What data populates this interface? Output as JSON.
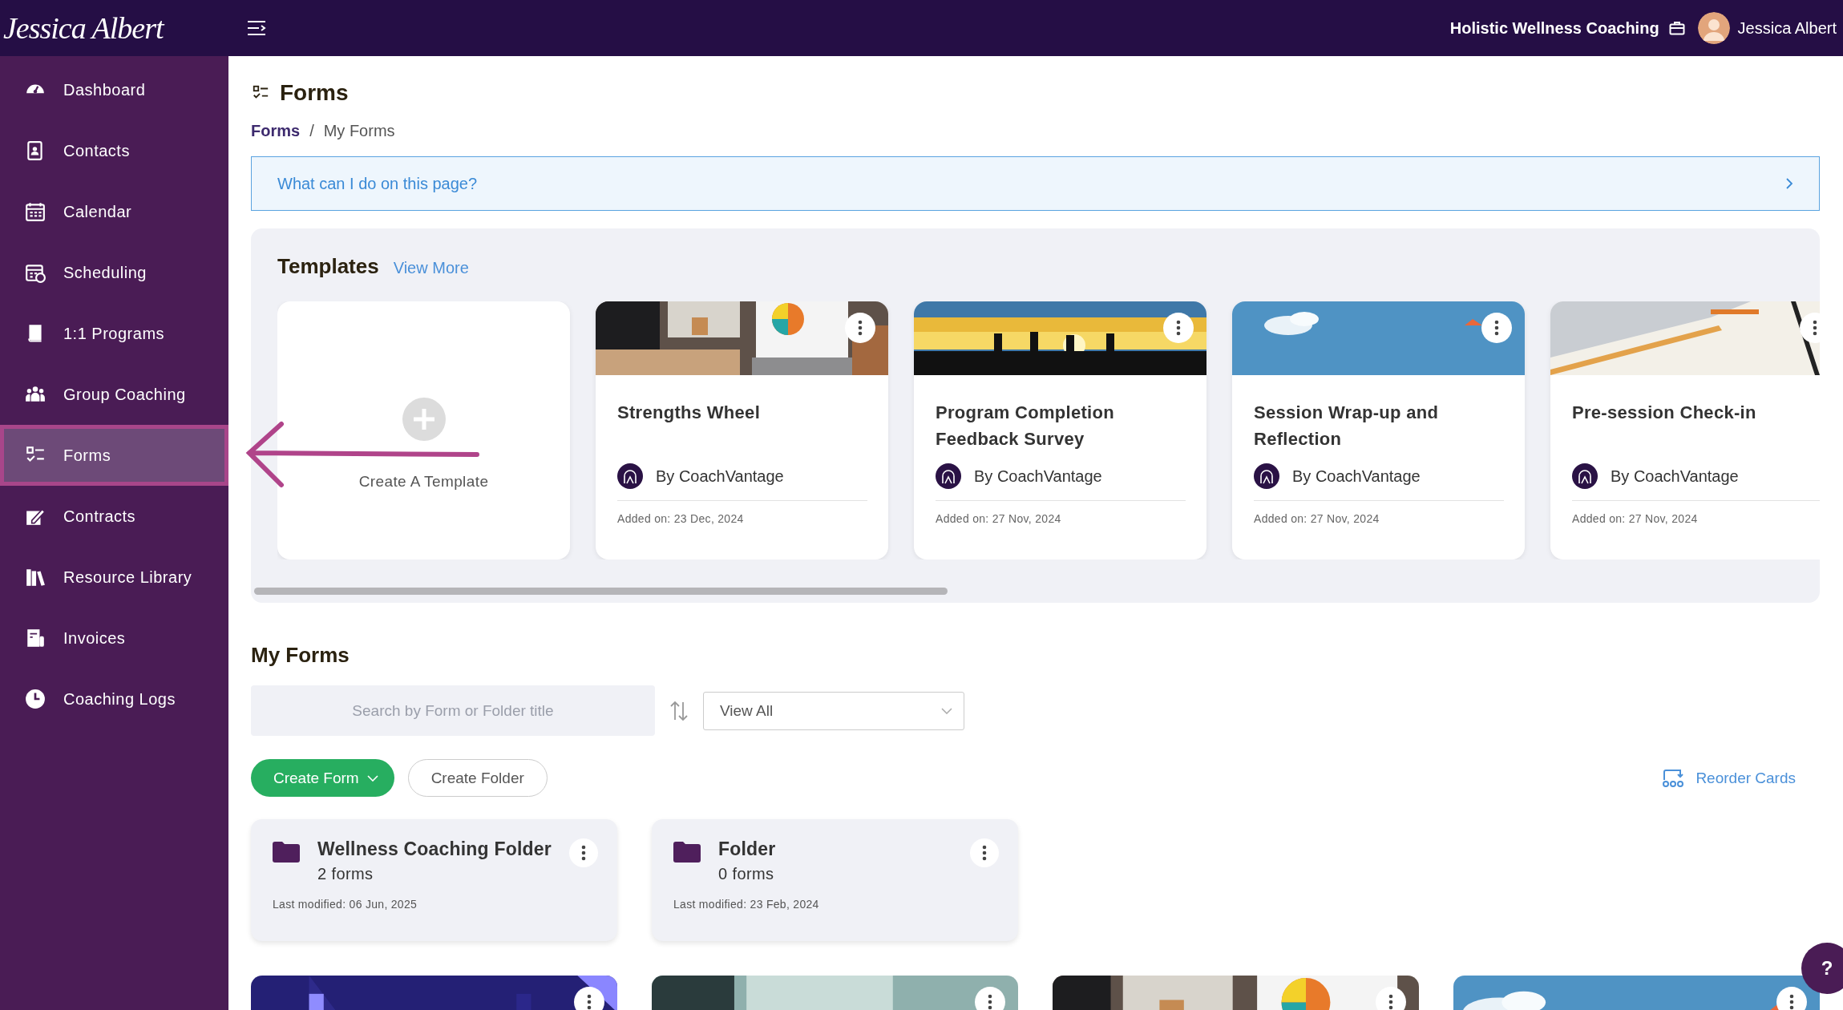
{
  "header": {
    "logo": "Jessica Albert",
    "business": "Holistic Wellness Coaching",
    "user": "Jessica Albert"
  },
  "sidebar": {
    "items": [
      {
        "label": "Dashboard",
        "selected": false
      },
      {
        "label": "Contacts",
        "selected": false
      },
      {
        "label": "Calendar",
        "selected": false
      },
      {
        "label": "Scheduling",
        "selected": false
      },
      {
        "label": "1:1 Programs",
        "selected": false
      },
      {
        "label": "Group Coaching",
        "selected": false
      },
      {
        "label": "Forms",
        "selected": true
      },
      {
        "label": "Contracts",
        "selected": false
      },
      {
        "label": "Resource Library",
        "selected": false
      },
      {
        "label": "Invoices",
        "selected": false
      },
      {
        "label": "Coaching Logs",
        "selected": false
      }
    ]
  },
  "page": {
    "title": "Forms",
    "breadcrumb": [
      "Forms",
      "My Forms"
    ],
    "breadcrumb_separator": "/",
    "help_bar": "What can I do on this page?"
  },
  "templates": {
    "title": "Templates",
    "view_more": "View More",
    "create_label": "Create A Template",
    "cards": [
      {
        "kind": "picture",
        "title": "Strengths Wheel",
        "author": "By CoachVantage",
        "added": "Added on: 23 Dec, 2024"
      },
      {
        "kind": "picture",
        "title": "Program Completion Feedback Survey",
        "author": "By CoachVantage",
        "added": "Added on: 27 Nov, 2024"
      },
      {
        "kind": "picture",
        "title": "Session Wrap-up and Reflection",
        "author": "By CoachVantage",
        "added": "Added on: 27 Nov, 2024"
      },
      {
        "kind": "picture",
        "title": "Pre-session Check-in",
        "author": "By CoachVantage",
        "added": "Added on: 27 Nov, 2024"
      }
    ]
  },
  "my_forms": {
    "title": "My Forms",
    "search": {
      "placeholder": "Search by Form or Folder title"
    },
    "filter": "View All",
    "create_form": "Create Form",
    "create_folder": "Create Folder",
    "reorder": "Reorder Cards",
    "folders": [
      {
        "name": "Wellness Coaching Folder",
        "count": "2 forms",
        "modified": "Last modified: 06 Jun, 2025"
      },
      {
        "name": "Folder",
        "count": "0 forms",
        "modified": "Last modified: 23 Feb, 2024"
      }
    ]
  },
  "help_button": "?"
}
